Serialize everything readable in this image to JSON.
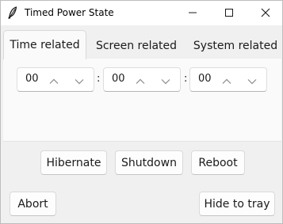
{
  "window": {
    "title": "Timed Power State",
    "app_icon": "feather-icon",
    "controls": [
      "minimize-icon",
      "maximize-icon",
      "close-icon"
    ]
  },
  "tabs": [
    {
      "label": "Time related",
      "active": true
    },
    {
      "label": "Screen related",
      "active": false
    },
    {
      "label": "System related",
      "active": false
    }
  ],
  "time": {
    "hours": "00",
    "minutes": "00",
    "seconds": "00",
    "separator": ":"
  },
  "actions": {
    "hibernate": "Hibernate",
    "shutdown": "Shutdown",
    "reboot": "Reboot"
  },
  "footer": {
    "abort": "Abort",
    "hide_to_tray": "Hide to tray"
  }
}
